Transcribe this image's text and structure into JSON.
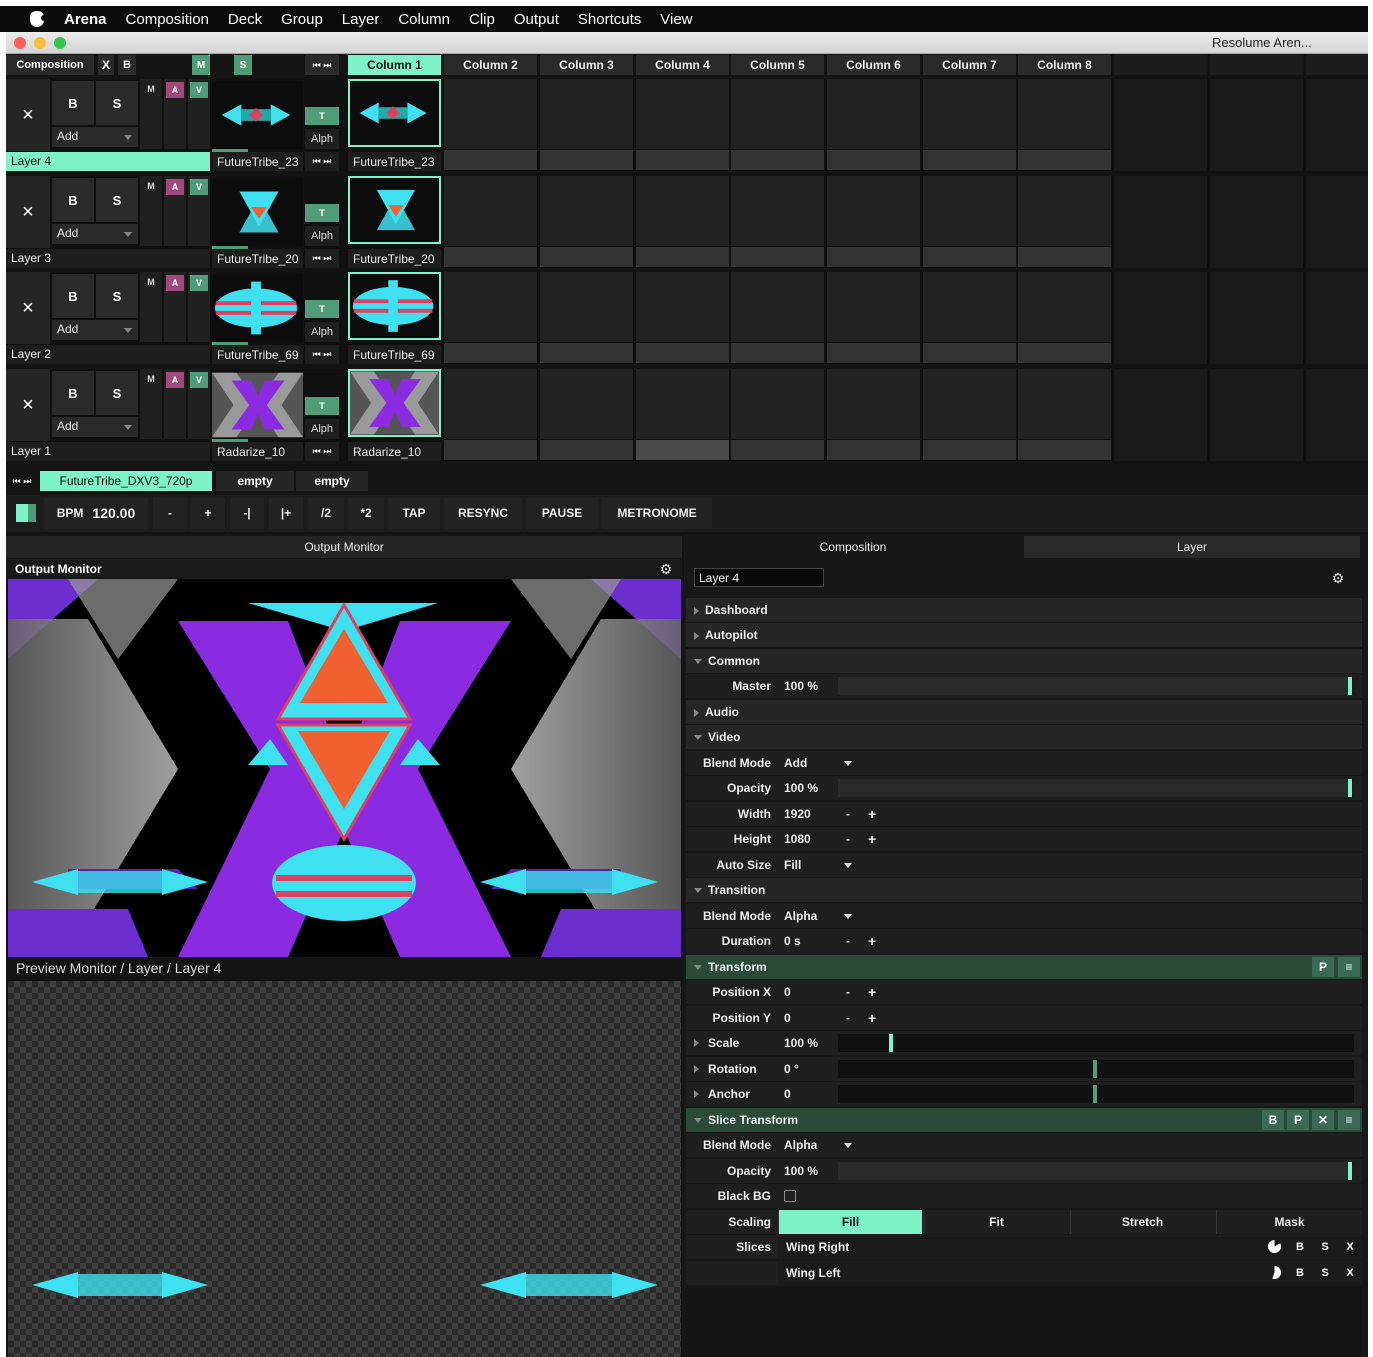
{
  "menubar": {
    "app": "Arena",
    "items": [
      "Composition",
      "Deck",
      "Group",
      "Layer",
      "Column",
      "Clip",
      "Output",
      "Shortcuts",
      "View"
    ]
  },
  "window": {
    "title": "Resolume Aren..."
  },
  "comp_header": {
    "label": "Composition",
    "x": "X",
    "b": "B",
    "m": "M",
    "s": "S",
    "nav": "⏮ ⏭"
  },
  "columns": [
    "Column 1",
    "Column 2",
    "Column 3",
    "Column 4",
    "Column 5",
    "Column 6",
    "Column 7",
    "Column 8"
  ],
  "layer_controls": {
    "x": "×",
    "b": "B",
    "s": "S",
    "add": "Add",
    "m": "M",
    "a": "A",
    "v": "V",
    "t": "T",
    "alph": "Alph",
    "nav": "⏮ ⏭"
  },
  "layers": [
    {
      "name": "Layer 4",
      "clip": "FutureTribe_23",
      "active": true
    },
    {
      "name": "Layer 3",
      "clip": "FutureTribe_20",
      "active": false
    },
    {
      "name": "Layer 2",
      "clip": "FutureTribe_69",
      "active": false
    },
    {
      "name": "Layer 1",
      "clip": "Radarize_10",
      "active": false
    }
  ],
  "decks": {
    "nav": "⏮ ⏭",
    "items": [
      "FutureTribe_DXV3_720p",
      "empty",
      "empty"
    ]
  },
  "transport": {
    "bpm_label": "BPM",
    "bpm": "120.00",
    "minus": "-",
    "plus": "+",
    "nudge_back": "-|",
    "nudge_fwd": "|+",
    "half": "/2",
    "double": "*2",
    "tap": "TAP",
    "resync": "RESYNC",
    "pause": "PAUSE",
    "metronome": "METRONOME"
  },
  "output": {
    "tab": "Output Monitor",
    "title": "Output Monitor",
    "preview_title": "Preview Monitor / Layer / Layer 4"
  },
  "inspector": {
    "tabs": [
      "Composition",
      "Layer"
    ],
    "layer_name": "Layer 4",
    "sections": {
      "dashboard": "Dashboard",
      "autopilot": "Autopilot",
      "common": "Common",
      "audio": "Audio",
      "video": "Video",
      "transition": "Transition",
      "transform": "Transform",
      "slice_transform": "Slice Transform"
    },
    "common": {
      "master_label": "Master",
      "master": "100 %",
      "master_level": 1.0
    },
    "video": {
      "blend_label": "Blend Mode",
      "blend": "Add",
      "opacity_label": "Opacity",
      "opacity": "100 %",
      "opacity_level": 1.0,
      "width_label": "Width",
      "width": "1920",
      "height_label": "Height",
      "height": "1080",
      "autosize_label": "Auto Size",
      "autosize": "Fill"
    },
    "transition": {
      "blend_label": "Blend Mode",
      "blend": "Alpha",
      "duration_label": "Duration",
      "duration": "0 s"
    },
    "transform": {
      "buttons": [
        "P",
        "≡"
      ],
      "posx_label": "Position X",
      "posx": "0",
      "posy_label": "Position Y",
      "posy": "0",
      "scale_label": "Scale",
      "scale": "100 %",
      "scale_level": 0.1,
      "rotation_label": "Rotation",
      "rotation": "0 °",
      "rotation_level": 0.5,
      "anchor_label": "Anchor",
      "anchor": "0",
      "anchor_level": 0.5
    },
    "slice": {
      "buttons": [
        "B",
        "P",
        "✕",
        "≡"
      ],
      "blend_label": "Blend Mode",
      "blend": "Alpha",
      "opacity_label": "Opacity",
      "opacity": "100 %",
      "opacity_level": 1.0,
      "blackbg_label": "Black BG",
      "scaling_label": "Scaling",
      "scaling_options": [
        "Fill",
        "Fit",
        "Stretch",
        "Mask"
      ],
      "slices_label": "Slices",
      "slices": [
        {
          "name": "Wing Right"
        },
        {
          "name": "Wing Left"
        }
      ],
      "slice_btns": [
        "B",
        "S",
        "X"
      ]
    },
    "pm": {
      "minus": "-",
      "plus": "+"
    }
  },
  "colors": {
    "accent": "#7ef2c8",
    "purple": "#8a2be2",
    "cyan": "#3fe0f0"
  }
}
